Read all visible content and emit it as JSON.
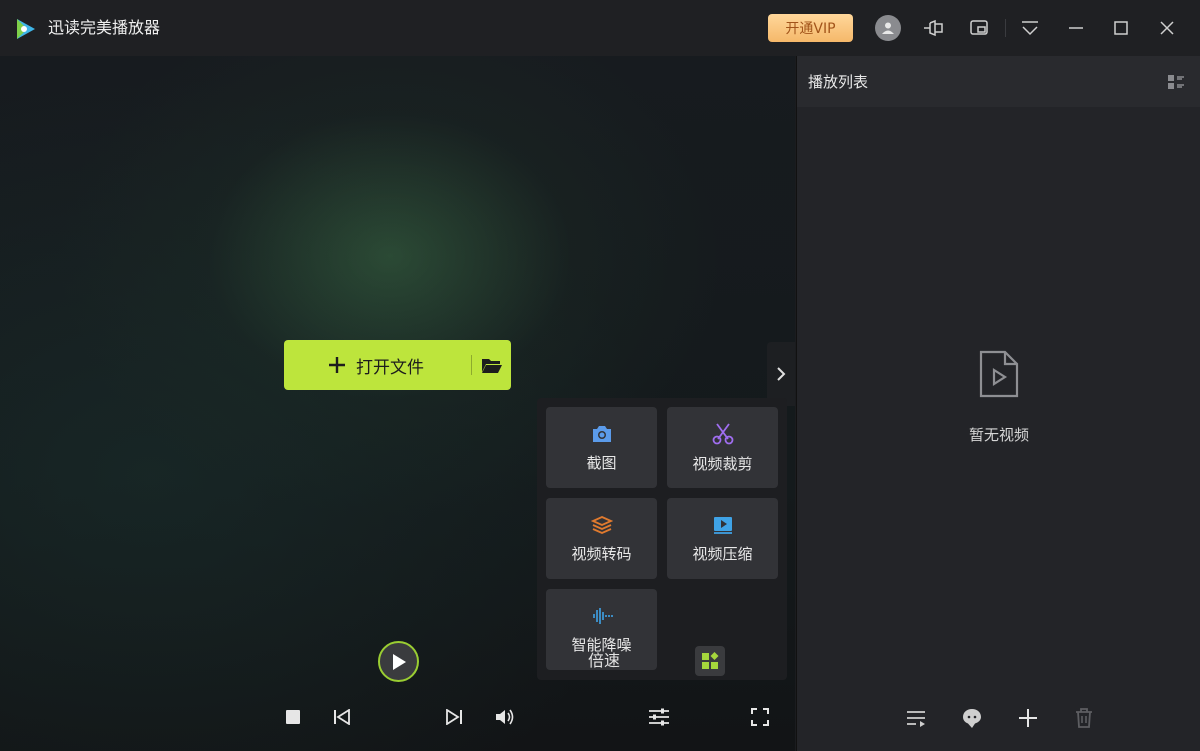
{
  "app": {
    "title": "迅读完美播放器"
  },
  "titlebar": {
    "vip_label": "开通VIP"
  },
  "player": {
    "open_file_label": "打开文件",
    "speed_label": "倍速"
  },
  "tools": [
    {
      "label": "截图",
      "icon": "camera-icon",
      "color": "#5b9bea"
    },
    {
      "label": "视频裁剪",
      "icon": "scissors-icon",
      "color": "#a06ef0"
    },
    {
      "label": "视频转码",
      "icon": "layers-icon",
      "color": "#e07a2e"
    },
    {
      "label": "视频压缩",
      "icon": "video-compress-icon",
      "color": "#3fa3e6"
    },
    {
      "label": "智能降噪",
      "icon": "waveform-icon",
      "color": "#3fa3e6"
    }
  ],
  "playlist": {
    "title": "播放列表",
    "empty_text": "暂无视频"
  },
  "colors": {
    "accent": "#bde53c",
    "vip": "#f5b86a",
    "background": "#1b1c1f"
  }
}
